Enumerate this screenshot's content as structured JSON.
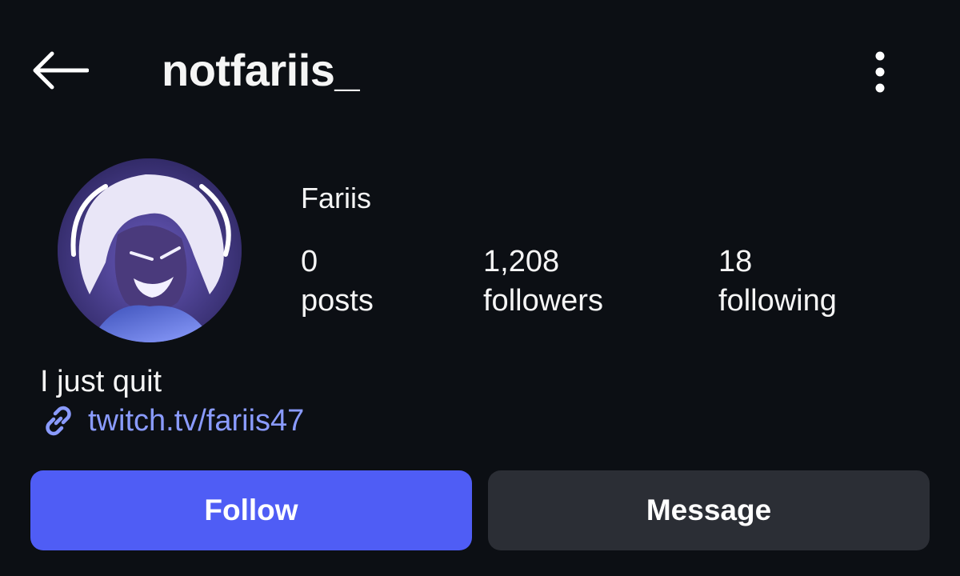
{
  "header": {
    "username": "notfariis_",
    "back_icon": "arrow-left-icon",
    "more_icon": "kebab-vertical-icon"
  },
  "profile": {
    "display_name": "Fariis",
    "avatar_icon": "profile-avatar",
    "stats": [
      {
        "value": "0",
        "label": "posts"
      },
      {
        "value": "1,208",
        "label": "followers"
      },
      {
        "value": "18",
        "label": "following"
      }
    ],
    "bio": "I just quit",
    "link": {
      "text": "twitch.tv/fariis47",
      "icon": "link-icon"
    }
  },
  "actions": {
    "follow_label": "Follow",
    "message_label": "Message"
  },
  "colors": {
    "background": "#0c0f14",
    "accent": "#4f5df5",
    "link": "#8a9bff",
    "secondary_button": "#2b2e35"
  }
}
